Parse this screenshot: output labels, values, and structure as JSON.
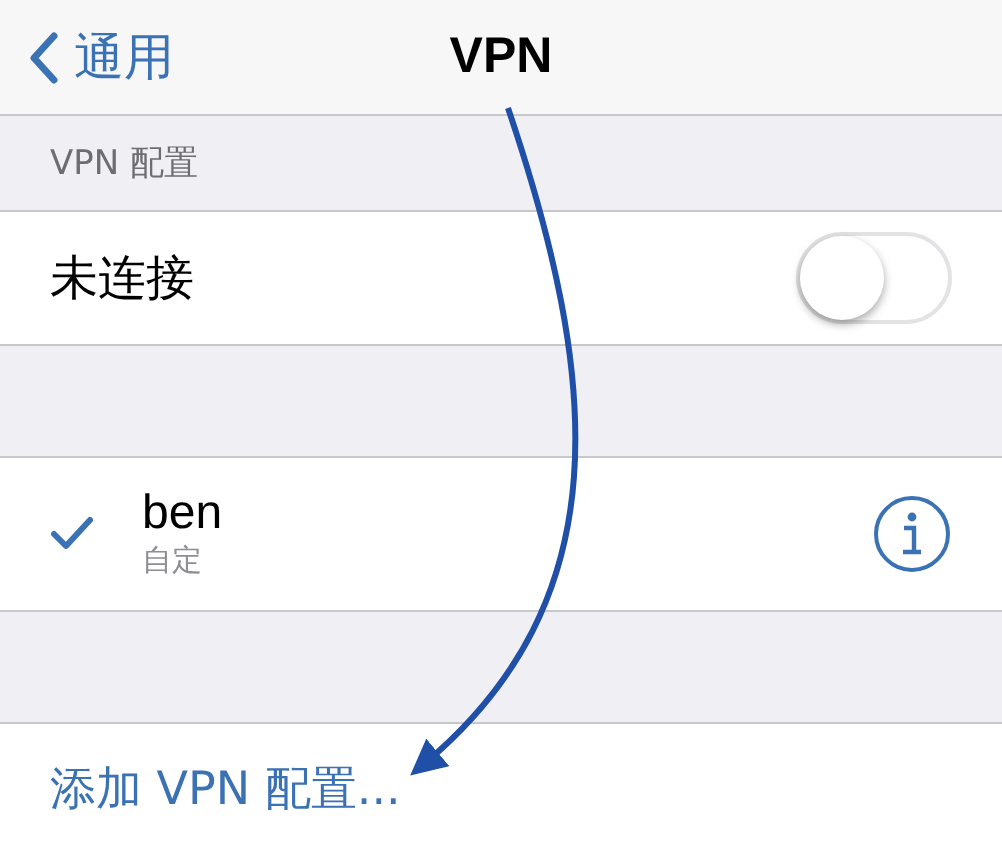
{
  "nav_bar": {
    "back_label": "通用",
    "title": "VPN"
  },
  "section_header": "VPN 配置",
  "status_row": {
    "label": "未连接",
    "on": false
  },
  "vpn_configs": [
    {
      "name": "ben",
      "type": "自定",
      "selected": true
    }
  ],
  "add_link": "添加 VPN 配置..."
}
